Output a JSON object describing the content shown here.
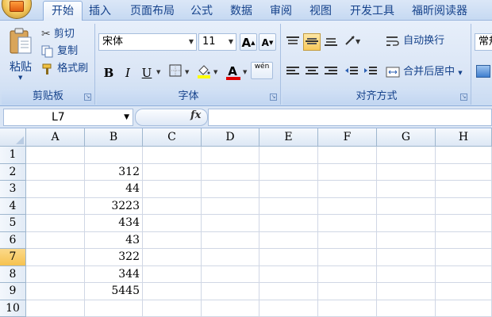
{
  "tabs": [
    {
      "label": "开始",
      "active": true
    },
    {
      "label": "插入"
    },
    {
      "label": "页面布局"
    },
    {
      "label": "公式"
    },
    {
      "label": "数据"
    },
    {
      "label": "审阅"
    },
    {
      "label": "视图"
    },
    {
      "label": "开发工具"
    },
    {
      "label": "福昕阅读器"
    }
  ],
  "clipboard": {
    "paste": "粘贴",
    "cut": "剪切",
    "copy": "复制",
    "format_painter": "格式刷",
    "label": "剪贴板"
  },
  "font": {
    "name": "宋体",
    "size": "11",
    "bold": "B",
    "italic": "I",
    "underline": "U",
    "grow": "A",
    "shrink": "A",
    "font_color_letter": "A",
    "phonetic": "wén",
    "label": "字体"
  },
  "alignment": {
    "wrap_text": "自动换行",
    "merge_center": "合并后居中",
    "label": "对齐方式"
  },
  "number": {
    "format": "常规"
  },
  "colors": {
    "font_color": "#e00000",
    "fill_color": "#ffff00",
    "selected_row": "#f6c24f"
  },
  "formula_bar": {
    "name_box": "L7",
    "fx": "fx",
    "formula": ""
  },
  "sheet": {
    "columns": [
      "A",
      "B",
      "C",
      "D",
      "E",
      "F",
      "G",
      "H"
    ],
    "rows": [
      "1",
      "2",
      "3",
      "4",
      "5",
      "6",
      "7",
      "8",
      "9",
      "10"
    ],
    "selected_row": "7",
    "b_values": [
      "",
      "312",
      "44",
      "3223",
      "434",
      "43",
      "322",
      "344",
      "5445",
      ""
    ]
  }
}
